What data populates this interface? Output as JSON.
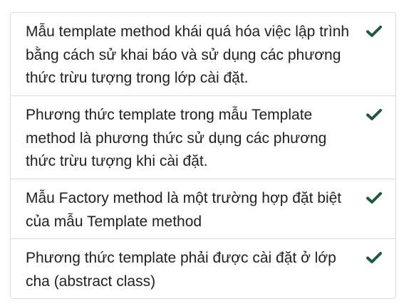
{
  "answers": [
    {
      "text": "Mẫu template method khái quá hóa việc lập trình bằng cách sử khai báo và sử dụng các phương thức trừu tượng trong lớp cài đặt.",
      "icon": "check-icon",
      "checked": true
    },
    {
      "text": "Phương thức template trong mẫu Template method là phương thức sử dụng các phương thức trừu tượng khi cài đặt.",
      "icon": "check-icon",
      "checked": true
    },
    {
      "text": "Mẫu Factory method là một trường hợp đặt biệt của mẫu Template method",
      "icon": "check-icon",
      "checked": true
    },
    {
      "text": "Phương thức template phải được cài đặt ở lớp cha (abstract class)",
      "icon": "check-icon",
      "checked": true
    }
  ],
  "colors": {
    "check": "#1f5a3f",
    "border": "#dcdcdc",
    "text": "#1f1f1f"
  }
}
